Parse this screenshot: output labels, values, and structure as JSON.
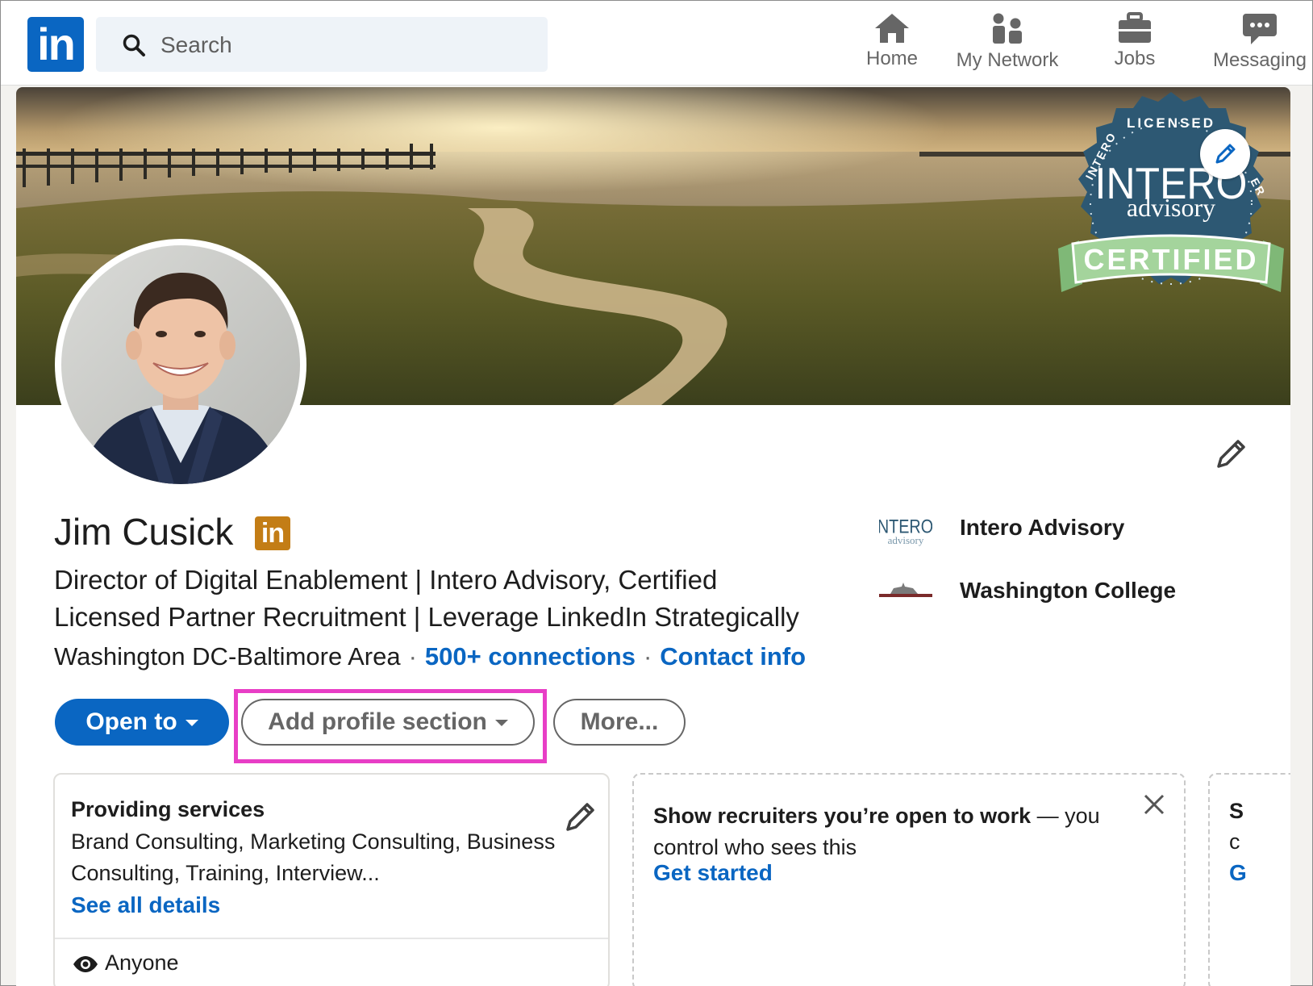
{
  "nav": {
    "logo_text": "in",
    "search_placeholder": "Search",
    "items": [
      {
        "label": "Home",
        "icon": "home-icon"
      },
      {
        "label": "My Network",
        "icon": "network-icon"
      },
      {
        "label": "Jobs",
        "icon": "briefcase-icon"
      },
      {
        "label": "Messaging",
        "icon": "chat-icon"
      }
    ]
  },
  "banner": {
    "badge": {
      "top": "LICENSED",
      "left": "INTERO",
      "right": "ER",
      "brand": "INTERO",
      "sub": "advisory",
      "ribbon": "CERTIFIED"
    }
  },
  "profile": {
    "name": "Jim Cusick",
    "premium_badge": "in",
    "headline": "Director of Digital Enablement | Intero Advisory, Certified Licensed Partner Recruitment | Leverage LinkedIn Strategically",
    "location": "Washington DC-Baltimore Area",
    "separator": "·",
    "connections": "500+ connections",
    "contact": "Contact info"
  },
  "orgs": [
    {
      "name": "Intero Advisory",
      "logo_top": "INTERO",
      "logo_sub": "advisory"
    },
    {
      "name": "Washington College"
    }
  ],
  "actions": {
    "open_to": "Open to",
    "add_section": "Add profile section",
    "more": "More..."
  },
  "services_card": {
    "title": "Providing services",
    "text": "Brand Consulting, Marketing Consulting, Business Consulting, Training, Interview...",
    "link": "See all details",
    "audience": "Anyone"
  },
  "recruiter_card": {
    "bold": "Show recruiters you’re open to work",
    "rest": " — you control who sees this",
    "link": "Get started"
  },
  "third_card": {
    "a": "S",
    "b": "c",
    "c": "G"
  },
  "colors": {
    "brand_blue": "#0a66c2",
    "highlight": "#e83ec6",
    "premium_gold": "#c37d16"
  }
}
